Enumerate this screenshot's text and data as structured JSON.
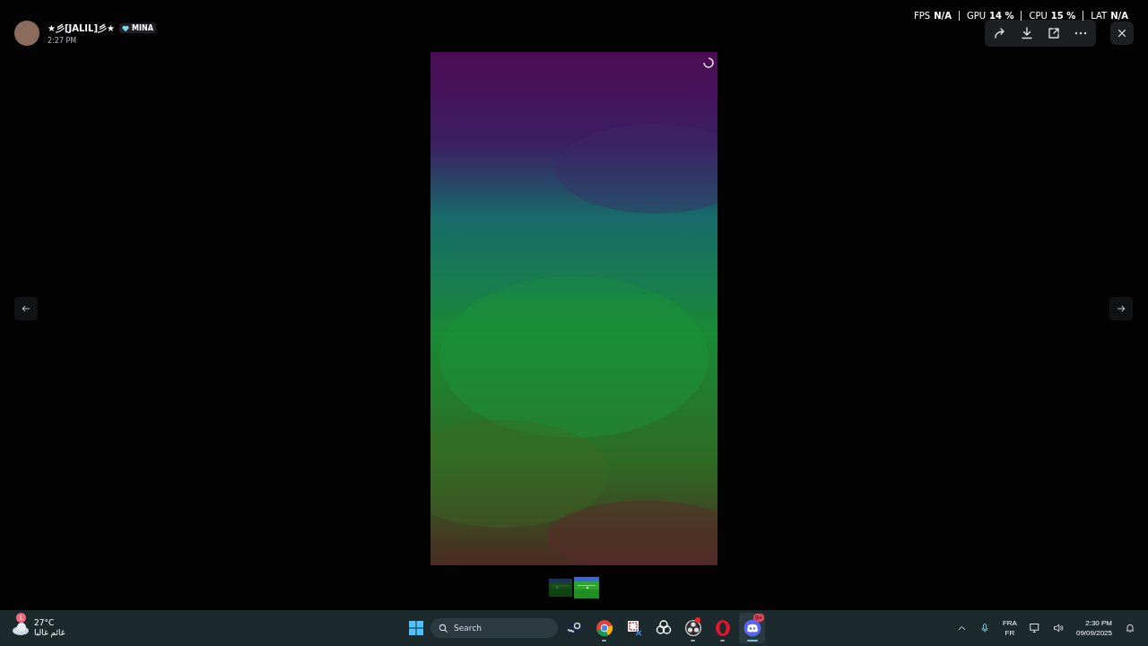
{
  "viewer": {
    "author": {
      "name": "★彡[JALIL]彡★",
      "badge": "MINA",
      "time": "2:27 PM"
    },
    "toolbar": [
      {
        "kind": "forward"
      },
      {
        "kind": "download"
      },
      {
        "kind": "external"
      },
      {
        "kind": "more"
      }
    ],
    "image": {
      "kind": "picture",
      "loading": true
    },
    "thumbnails": [
      {
        "kind": "picture",
        "selected": false
      },
      {
        "kind": "picture",
        "selected": true
      }
    ]
  },
  "performance_overlay": [
    {
      "label": "FPS",
      "value": "N/A"
    },
    {
      "label": "GPU",
      "value": "14 %"
    },
    {
      "label": "CPU",
      "value": "15 %"
    },
    {
      "label": "LAT",
      "value": "N/A"
    }
  ],
  "taskbar": {
    "weather": {
      "temperature": "27°C",
      "condition": "غائم غالبا",
      "badge": "1"
    },
    "search": {
      "placeholder": "Search"
    },
    "apps": [
      {
        "kind": "steam",
        "open": false,
        "selected": false
      },
      {
        "kind": "chrome",
        "open": true,
        "selected": false
      },
      {
        "kind": "snipping",
        "open": false,
        "selected": false
      },
      {
        "kind": "chatgpt",
        "open": false,
        "selected": false
      },
      {
        "kind": "obs",
        "open": true,
        "selected": false,
        "badge_dot": true
      },
      {
        "kind": "opera",
        "open": true,
        "selected": false
      },
      {
        "kind": "discord",
        "open": true,
        "selected": true,
        "badge": "9+"
      }
    ],
    "language": {
      "top": "FRA",
      "bottom": "FR"
    },
    "clock": {
      "time": "2:30 PM",
      "date": "09/09/2025"
    }
  }
}
